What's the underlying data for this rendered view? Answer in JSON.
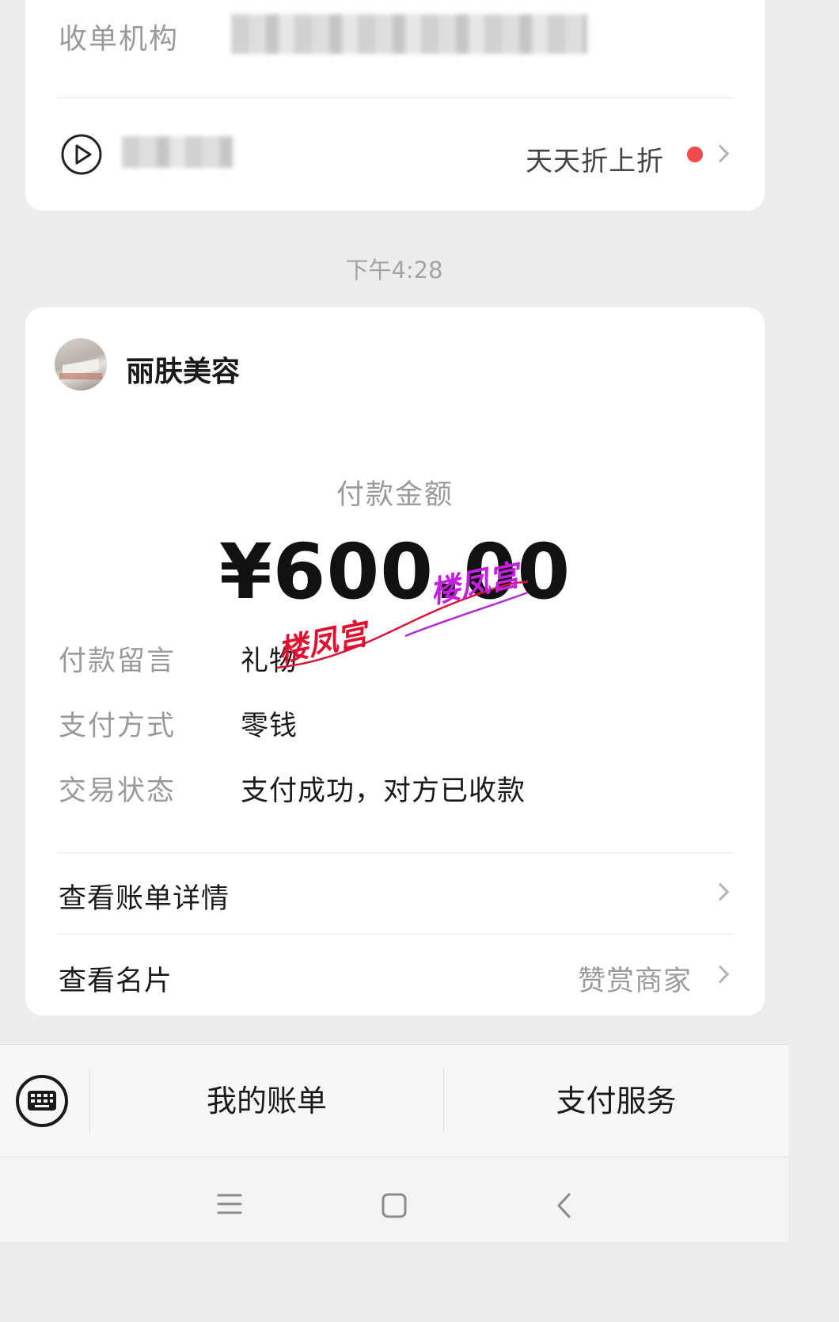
{
  "top_card": {
    "merchant_label": "收单机构",
    "promo_text": "天天折上折",
    "colors": {
      "badge": "#f04a4a"
    }
  },
  "timestamp": "下午4:28",
  "payment": {
    "merchant_name": "丽肤美容",
    "amount_label": "付款金额",
    "amount": "¥600.00",
    "details": [
      {
        "label": "付款留言",
        "value": "礼物"
      },
      {
        "label": "支付方式",
        "value": "零钱"
      },
      {
        "label": "交易状态",
        "value": "支付成功，对方已收款"
      }
    ],
    "links": {
      "bill_details": "查看账单详情",
      "view_card": "查看名片",
      "reward_merchant": "赞赏商家"
    }
  },
  "watermark": {
    "text_1": "楼凤宫",
    "text_2": "楼凤宫"
  },
  "bottom_bar": {
    "my_bills": "我的账单",
    "pay_service": "支付服务"
  },
  "icons": [
    "play-circle-icon",
    "chevron-right-icon",
    "keyboard-icon",
    "menu-icon",
    "home-square-icon",
    "back-icon"
  ]
}
